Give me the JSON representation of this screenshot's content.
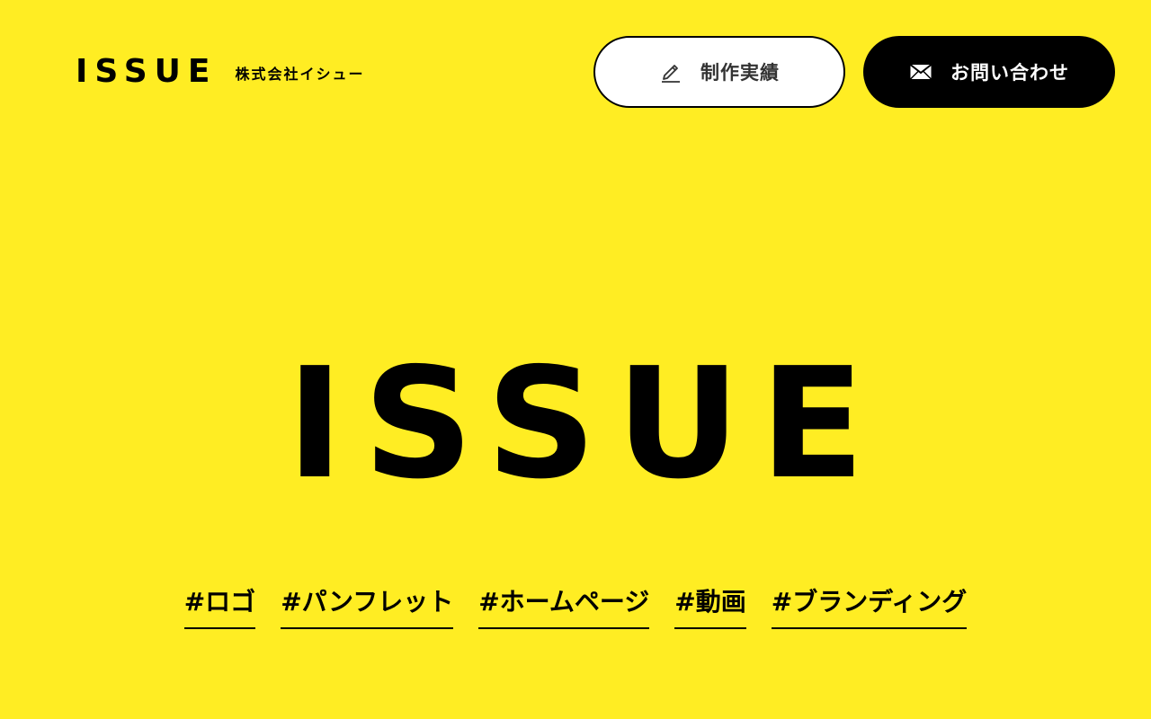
{
  "header": {
    "logo": "ISSUE",
    "company_name": "株式会社イシュー",
    "works_button": {
      "label": "制作実績",
      "icon": "pencil-icon"
    },
    "contact_button": {
      "label": "お問い合わせ",
      "icon": "envelope-icon"
    }
  },
  "hero": {
    "title": "ISSUE"
  },
  "tags": [
    "#ロゴ",
    "#パンフレット",
    "#ホームページ",
    "#動画",
    "#ブランディング"
  ],
  "colors": {
    "background": "#FFED23",
    "text": "#000000",
    "button_light": "#FFFFFF",
    "button_dark": "#000000"
  }
}
